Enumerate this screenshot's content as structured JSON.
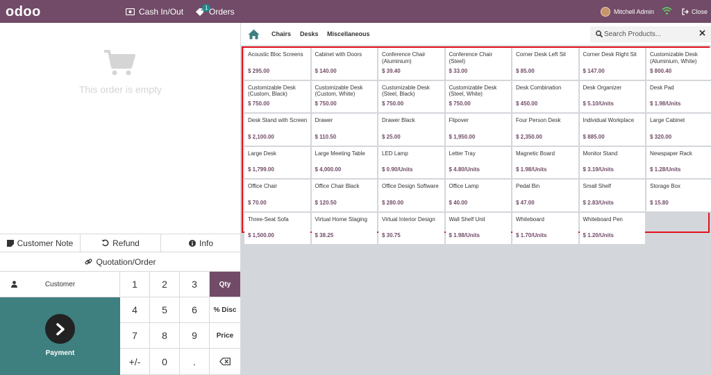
{
  "header": {
    "logo": "odoo",
    "cash_label": "Cash In/Out",
    "orders_label": "Orders",
    "orders_badge": "1",
    "user_name": "Mitchell Admin",
    "close_label": "Close"
  },
  "order": {
    "empty_text": "This order is empty"
  },
  "actions": {
    "customer_note": "Customer Note",
    "refund": "Refund",
    "info": "Info",
    "quotation": "Quotation/Order"
  },
  "pad": {
    "customer": "Customer",
    "payment": "Payment",
    "keys": [
      "1",
      "2",
      "3",
      "Qty",
      "4",
      "5",
      "6",
      "% Disc",
      "7",
      "8",
      "9",
      "Price",
      "+/-",
      "0",
      ".",
      "⌫"
    ]
  },
  "categories": [
    "Chairs",
    "Desks",
    "Miscellaneous"
  ],
  "search": {
    "placeholder": "Search Products..."
  },
  "colors": {
    "brand": "#714b67",
    "payment": "#3e7f7f",
    "highlight": "#e3101b"
  },
  "products": [
    {
      "name": "Acoustic Bloc Screens",
      "price": "$ 295.00"
    },
    {
      "name": "Cabinet with Doors",
      "price": "$ 140.00"
    },
    {
      "name": "Conference Chair (Aluminium)",
      "price": "$ 39.40"
    },
    {
      "name": "Conference Chair (Steel)",
      "price": "$ 33.00"
    },
    {
      "name": "Corner Desk Left Sit",
      "price": "$ 85.00"
    },
    {
      "name": "Corner Desk Right Sit",
      "price": "$ 147.00"
    },
    {
      "name": "Customizable Desk (Aluminium, White)",
      "price": "$ 800.40"
    },
    {
      "name": "Customizable Desk (Custom, Black)",
      "price": "$ 750.00"
    },
    {
      "name": "Customizable Desk (Custom, White)",
      "price": "$ 750.00"
    },
    {
      "name": "Customizable Desk (Steel, Black)",
      "price": "$ 750.00"
    },
    {
      "name": "Customizable Desk (Steel, White)",
      "price": "$ 750.00"
    },
    {
      "name": "Desk Combination",
      "price": "$ 450.00"
    },
    {
      "name": "Desk Organizer",
      "price": "$ 5.10/Units"
    },
    {
      "name": "Desk Pad",
      "price": "$ 1.98/Units"
    },
    {
      "name": "Desk Stand with Screen",
      "price": "$ 2,100.00"
    },
    {
      "name": "Drawer",
      "price": "$ 110.50"
    },
    {
      "name": "Drawer Black",
      "price": "$ 25.00"
    },
    {
      "name": "Flipover",
      "price": "$ 1,950.00"
    },
    {
      "name": "Four Person Desk",
      "price": "$ 2,350.00"
    },
    {
      "name": "Individual Workplace",
      "price": "$ 885.00"
    },
    {
      "name": "Large Cabinet",
      "price": "$ 320.00"
    },
    {
      "name": "Large Desk",
      "price": "$ 1,799.00"
    },
    {
      "name": "Large Meeting Table",
      "price": "$ 4,000.00"
    },
    {
      "name": "LED Lamp",
      "price": "$ 0.90/Units"
    },
    {
      "name": "Letter Tray",
      "price": "$ 4.80/Units"
    },
    {
      "name": "Magnetic Board",
      "price": "$ 1.98/Units"
    },
    {
      "name": "Monitor Stand",
      "price": "$ 3.19/Units"
    },
    {
      "name": "Newspaper Rack",
      "price": "$ 1.28/Units"
    },
    {
      "name": "Office Chair",
      "price": "$ 70.00"
    },
    {
      "name": "Office Chair Black",
      "price": "$ 120.50"
    },
    {
      "name": "Office Design Software",
      "price": "$ 280.00"
    },
    {
      "name": "Office Lamp",
      "price": "$ 40.00"
    },
    {
      "name": "Pedal Bin",
      "price": "$ 47.00"
    },
    {
      "name": "Small Shelf",
      "price": "$ 2.83/Units"
    },
    {
      "name": "Storage Box",
      "price": "$ 15.80"
    },
    {
      "name": "Three-Seat Sofa",
      "price": "$ 1,500.00"
    },
    {
      "name": "Virtual Home Staging",
      "price": "$ 38.25"
    },
    {
      "name": "Virtual Interior Design",
      "price": "$ 30.75"
    },
    {
      "name": "Wall Shelf Unit",
      "price": "$ 1.98/Units"
    },
    {
      "name": "Whiteboard",
      "price": "$ 1.70/Units"
    },
    {
      "name": "Whiteboard Pen",
      "price": "$ 1.20/Units"
    }
  ]
}
